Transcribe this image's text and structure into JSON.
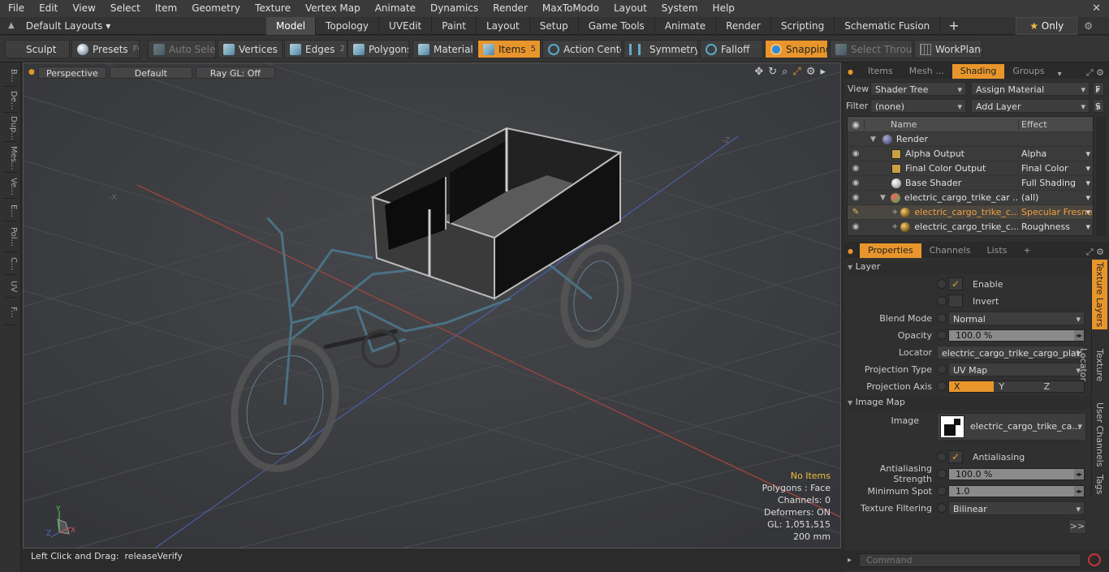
{
  "menu": [
    "File",
    "Edit",
    "View",
    "Select",
    "Item",
    "Geometry",
    "Texture",
    "Vertex Map",
    "Animate",
    "Dynamics",
    "Render",
    "MaxToModo",
    "Layout",
    "System",
    "Help"
  ],
  "layouts_label": "Default Layouts",
  "tabs": [
    "Model",
    "Topology",
    "UVEdit",
    "Paint",
    "Layout",
    "Setup",
    "Game Tools",
    "Animate",
    "Render",
    "Scripting",
    "Schematic Fusion"
  ],
  "only_label": "Only",
  "toolbar": {
    "sculpt": "Sculpt",
    "presets": "Presets",
    "presets_key": "F6",
    "auto_select": "Auto Select",
    "vertices": "Vertices",
    "vertices_num": "1",
    "edges": "Edges",
    "edges_num": "2",
    "polygons": "Polygons",
    "materials": "Materials",
    "items": "Items",
    "items_num": "5",
    "action_center": "Action Center",
    "symmetry": "Symmetry",
    "falloff": "Falloff",
    "snapping": "Snapping",
    "select_through": "Select Through",
    "workplane": "WorkPlane"
  },
  "left_strip": [
    "B...",
    "De...",
    "Dup...",
    "Mes...",
    "Ve...",
    "E...",
    "Pol...",
    "C...",
    "UV",
    "F..."
  ],
  "viewport": {
    "view": "Perspective",
    "shading": "Default",
    "raygl": "Ray GL: Off",
    "info": {
      "items": "No Items",
      "polygons": "Polygons : Face",
      "channels": "Channels: 0",
      "deformers": "Deformers: ON",
      "gl": "GL: 1,051,515",
      "scale": "200 mm"
    }
  },
  "status": {
    "label": "Left Click and Drag:",
    "value": "releaseVerify"
  },
  "shader_tabs": [
    "Items",
    "Mesh ...",
    "Shading",
    "Groups"
  ],
  "shader": {
    "view_label": "View",
    "view_value": "Shader Tree",
    "assign": "Assign Material",
    "filter_label": "Filter",
    "filter_value": "(none)",
    "add_layer": "Add Layer",
    "col_name": "Name",
    "col_effect": "Effect",
    "rows": [
      {
        "name": "Render",
        "effect": ""
      },
      {
        "name": "Alpha Output",
        "effect": "Alpha"
      },
      {
        "name": "Final Color Output",
        "effect": "Final Color"
      },
      {
        "name": "Base Shader",
        "effect": "Full Shading"
      },
      {
        "name": "electric_cargo_trike_car ...",
        "effect": "(all)"
      },
      {
        "name": "electric_cargo_trike_c...",
        "effect": "Specular Fresnel"
      },
      {
        "name": "electric_cargo_trike_c...",
        "effect": "Roughness"
      }
    ]
  },
  "prop_tabs": [
    "Properties",
    "Channels",
    "Lists"
  ],
  "props": {
    "layer": "Layer",
    "enable": "Enable",
    "invert": "Invert",
    "blend_label": "Blend Mode",
    "blend": "Normal",
    "opacity_label": "Opacity",
    "opacity": "100.0 %",
    "locator_label": "Locator",
    "locator": "electric_cargo_trike_cargo_plat...",
    "proj_type_label": "Projection Type",
    "proj_type": "UV Map",
    "proj_axis_label": "Projection Axis",
    "axes": [
      "X",
      "Y",
      "Z"
    ],
    "image_map": "Image Map",
    "image_label": "Image",
    "image": "electric_cargo_trike_ca...",
    "antialiasing": "Antialiasing",
    "aa_strength_label": "Antialiasing Strength",
    "aa_strength": "100.0 %",
    "min_spot_label": "Minimum Spot",
    "min_spot": "1.0",
    "filter_label": "Texture Filtering",
    "filter": "Bilinear",
    "more": ">>"
  },
  "side_tabs": [
    "Texture Layers",
    "Texture Locator",
    "User Channels",
    "Tags"
  ],
  "command_placeholder": "Command",
  "colors": {
    "accent": "#e8962c",
    "highlight": "#f0c040"
  }
}
